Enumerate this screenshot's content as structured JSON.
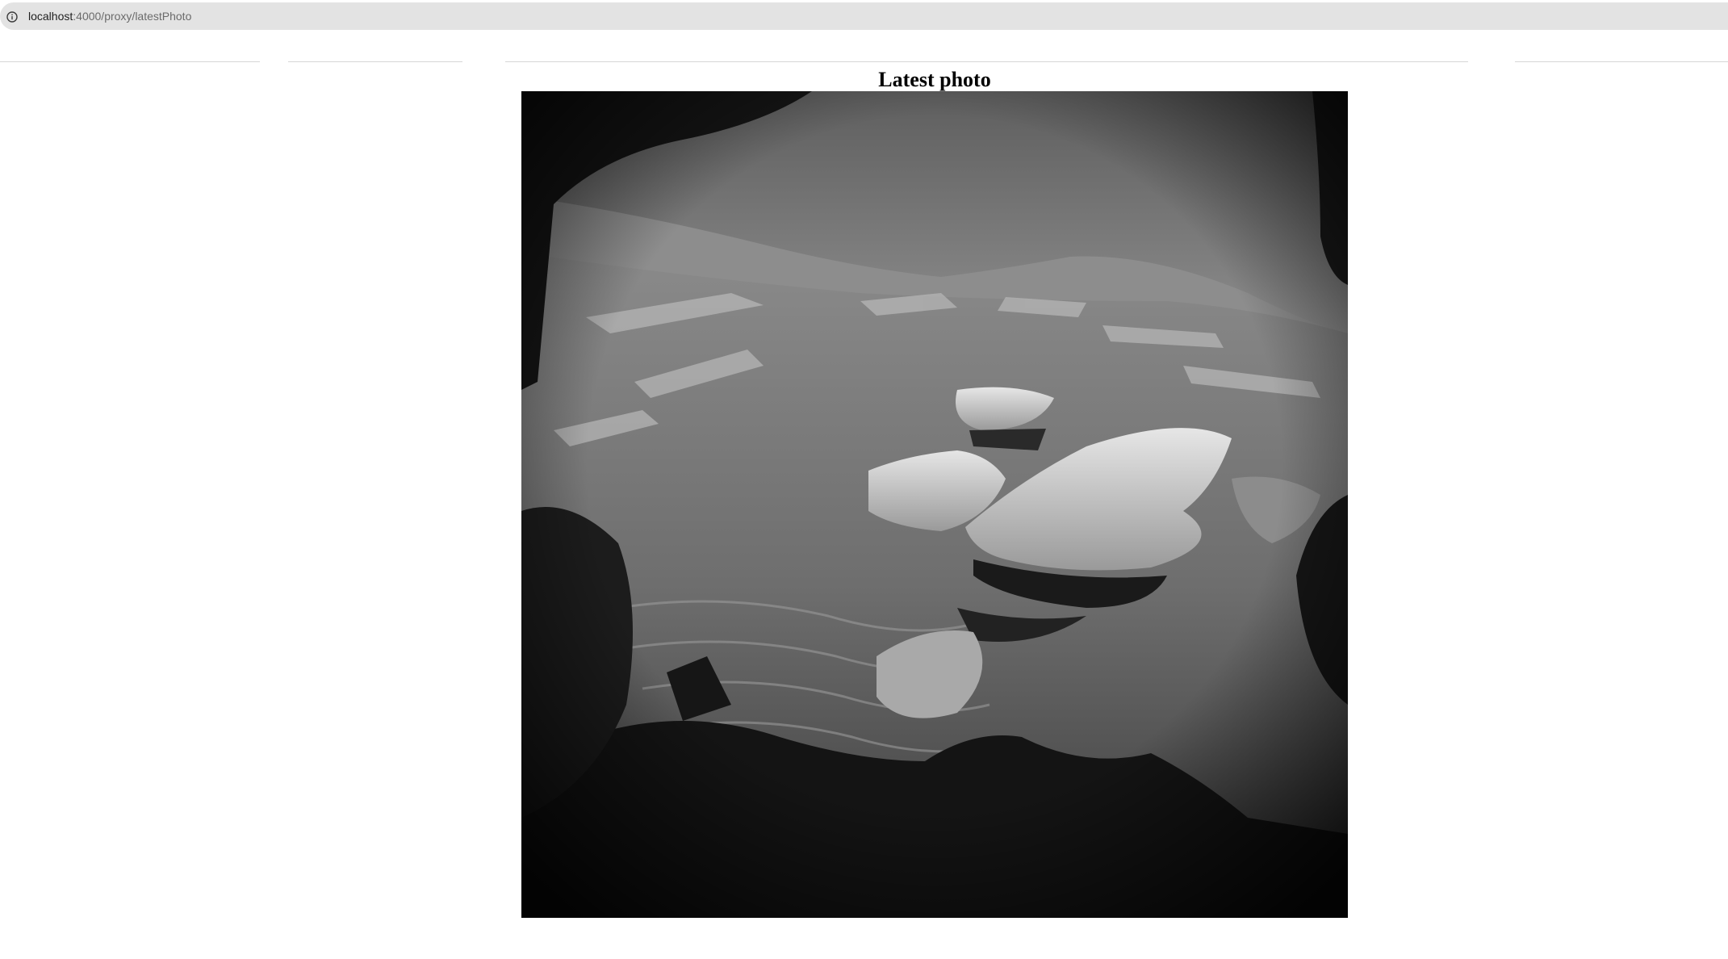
{
  "browser": {
    "url_host": "localhost",
    "url_rest": ":4000/proxy/latestPhoto",
    "info_icon": "info-circle-icon"
  },
  "page": {
    "title": "Latest photo"
  },
  "photo": {
    "description_kind": "grayscale rover navigation camera image",
    "colors": {
      "sky": "#cfcfcf",
      "ground": "#6e6e6e",
      "shadow": "#111111"
    }
  }
}
